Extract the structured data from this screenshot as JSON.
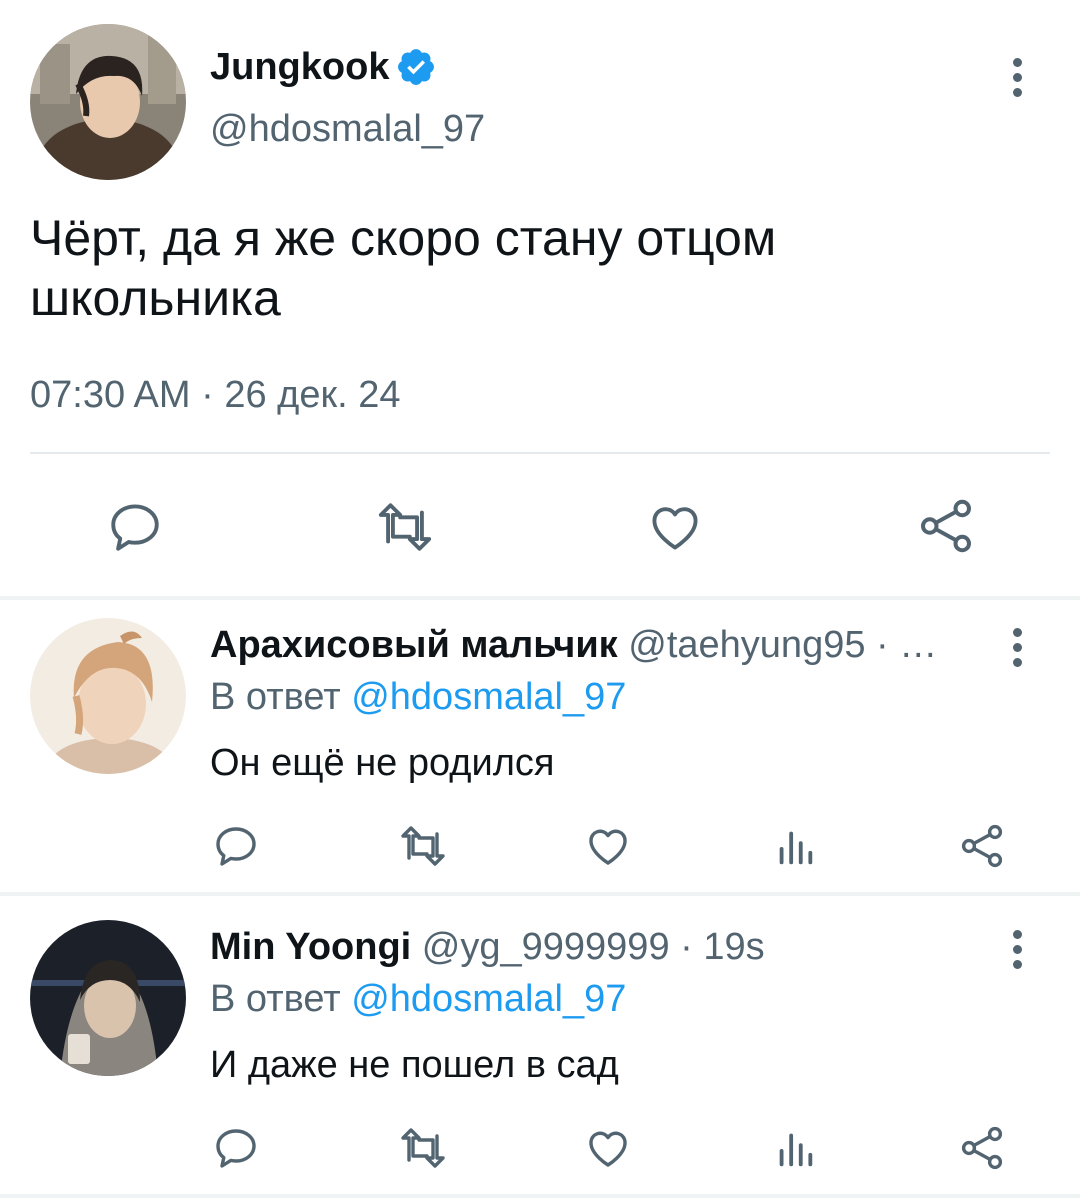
{
  "main_tweet": {
    "author_name": "Jungkook",
    "handle": "@hdosmalal_97",
    "text_line1": "Чёрт, да я же скоро стану отцом",
    "text_line2": "школьника",
    "timestamp": "07:30 AM · 26 дек. 24"
  },
  "replies": [
    {
      "author_name": "Арахисовый мальчик",
      "handle_meta": "@taehyung95 · …",
      "reply_prefix": "В ответ",
      "reply_to": "@hdosmalal_97",
      "text": "Он ещё не родился"
    },
    {
      "author_name": "Min Yoongi",
      "handle_meta": "@yg_9999999 · 19s",
      "reply_prefix": "В ответ",
      "reply_to": "@hdosmalal_97",
      "text": "И даже не пошел в сад"
    }
  ],
  "icons": {
    "verified": "verified-badge-icon",
    "reply": "reply-icon",
    "retweet": "retweet-icon",
    "like": "like-icon",
    "share": "share-icon",
    "views": "views-icon",
    "more": "more-options-icon"
  },
  "colors": {
    "link": "#1d9bf0",
    "secondary_text": "#536471",
    "primary_text": "#0f1419"
  }
}
